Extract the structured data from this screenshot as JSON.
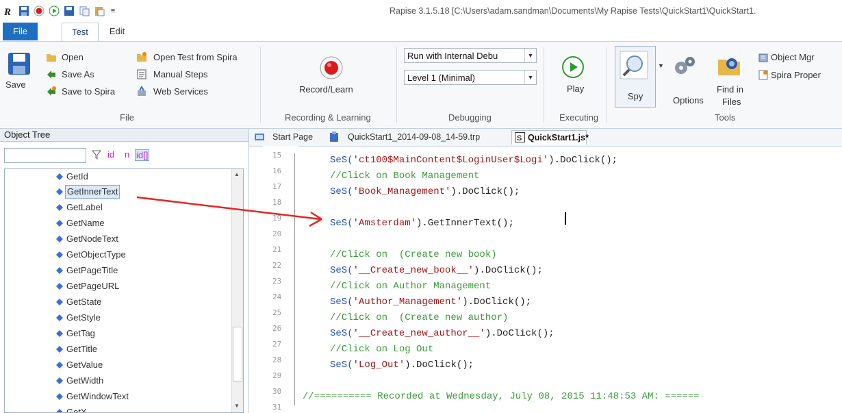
{
  "window": {
    "title": "Rapise 3.1.5.18 [C:\\Users\\adam.sandman\\Documents\\My Rapise Tests\\QuickStart1\\QuickStart1."
  },
  "tabs": {
    "file": "File",
    "test": "Test",
    "edit": "Edit"
  },
  "ribbon": {
    "file_group": {
      "save": "Save",
      "open": "Open",
      "save_as": "Save As",
      "save_to_spira": "Save to Spira",
      "open_from_spira": "Open Test from Spira",
      "manual_steps": "Manual Steps",
      "web_services": "Web Services",
      "label": "File"
    },
    "recording": {
      "record_learn": "Record/Learn",
      "label": "Recording & Learning"
    },
    "debugging": {
      "run_mode": "Run with Internal Debu",
      "level": "Level 1 (Minimal)",
      "label": "Debugging"
    },
    "executing": {
      "play": "Play",
      "label": "Executing"
    },
    "tools": {
      "spy": "Spy",
      "options": "Options",
      "find_in_files_1": "Find in",
      "find_in_files_2": "Files",
      "object_mgr": "Object Mgr",
      "spira_properties": "Spira Proper",
      "label": "Tools"
    }
  },
  "object_tree": {
    "title": "Object Tree",
    "filter_value": "",
    "toggle_id": "id",
    "toggle_n": "n",
    "toggle_idh": "id[]",
    "items": [
      "GetId",
      "GetInnerText",
      "GetLabel",
      "GetName",
      "GetNodeText",
      "GetObjectType",
      "GetPageTitle",
      "GetPageURL",
      "GetState",
      "GetStyle",
      "GetTag",
      "GetTitle",
      "GetValue",
      "GetWidth",
      "GetWindowText",
      "GetX"
    ],
    "selected": "GetInnerText"
  },
  "editor": {
    "doc_tabs": [
      "Start Page",
      "QuickStart1_2014-09-08_14-59.trp",
      "QuickStart1.js*"
    ],
    "line_numbers": [
      "15",
      "16",
      "17",
      "18",
      "19",
      "20",
      "21",
      "22",
      "23",
      "24",
      "25",
      "26",
      "27",
      "28",
      "29",
      "30",
      "31"
    ],
    "lines": {
      "l15_a": "SeS(",
      "l15_b": "'ct100$MainContent$LoginUser$Logi'",
      "l15_c": ").DoClick();",
      "l16": "//Click on Book Management",
      "l17_a": "SeS(",
      "l17_b": "'Book_Management'",
      "l17_c": ").DoClick();",
      "l19_a": "SeS(",
      "l19_b": "'Amsterdam'",
      "l19_c": ").GetInnerText();",
      "l21": "//Click on  (Create new book)",
      "l22_a": "SeS(",
      "l22_b": "'__Create_new_book__'",
      "l22_c": ").DoClick();",
      "l23": "//Click on Author Management",
      "l24_a": "SeS(",
      "l24_b": "'Author_Management'",
      "l24_c": ").DoClick();",
      "l25": "//Click on  (Create new author)",
      "l26_a": "SeS(",
      "l26_b": "'__Create_new_author__'",
      "l26_c": ").DoClick();",
      "l27": "//Click on Log Out",
      "l28_a": "SeS(",
      "l28_b": "'Log_Out'",
      "l28_c": ").DoClick();",
      "l30": "//========== Recorded at Wednesday, July 08, 2015 11:48:53 AM: ======"
    }
  },
  "colors": {
    "accent": "#1e6fc1",
    "arrow": "#e8251f",
    "string": "#a31515",
    "comment": "#3a9a3a",
    "function": "#1f4fb8"
  }
}
